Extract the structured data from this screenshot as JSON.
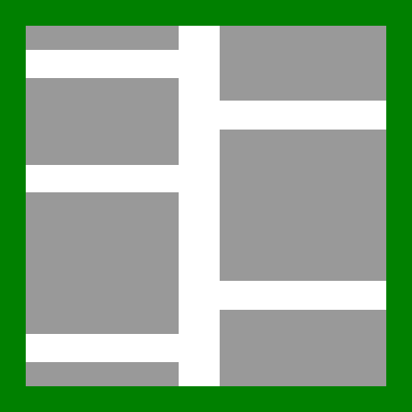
{
  "icon": {
    "name": "table-layout-icon",
    "colors": {
      "border": "#008000",
      "cell": "#999999",
      "gap": "#ffffff"
    },
    "columns": 2,
    "left_column_cells": 4,
    "right_column_cells": 3
  }
}
